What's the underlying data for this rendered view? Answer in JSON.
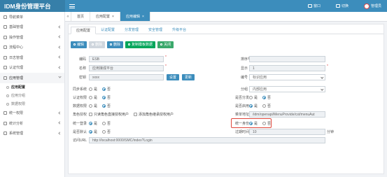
{
  "app": {
    "title": "IDM身份管理平台"
  },
  "topbar": {
    "item1": "窗口",
    "item2": "切换",
    "user": "管理员"
  },
  "sidebar": {
    "items": [
      {
        "label": "导航菜单"
      },
      {
        "label": "基础管理"
      },
      {
        "label": "操作管理"
      },
      {
        "label": "流程中心"
      },
      {
        "label": "日志管理"
      },
      {
        "label": "认证代理"
      },
      {
        "label": "应用管理"
      },
      {
        "label": "统一权限"
      },
      {
        "label": "统计分析"
      },
      {
        "label": "系统管理"
      }
    ],
    "subitems": [
      {
        "label": "应用配置"
      },
      {
        "label": "应用分组"
      },
      {
        "label": "数据权限"
      }
    ]
  },
  "page_tabs": {
    "home": "首页",
    "tab2": "应用配置",
    "tab3": "应用编辑"
  },
  "inner_tabs": [
    "应用配置",
    "认证配置",
    "分发管理",
    "安全管理",
    "升级平台"
  ],
  "toolbar": {
    "save": "编辑",
    "b2": "删除",
    "b3": "删除",
    "b4": "复制模板数据",
    "close": "关闭"
  },
  "form": {
    "code_label": "编码",
    "code_value": "ESB",
    "name_label": "名称",
    "name_value": "应用接成平台",
    "secret_label": "密钥",
    "secret_value": "xxxx",
    "set_btn": "设置",
    "refresh_btn": "更新",
    "sync_label": "同步系统",
    "sync_yes": "是",
    "sync_no": "否",
    "auth_label": "认证权限",
    "auth_yes": "是",
    "auth_no": "否",
    "data_label": "数据权限",
    "data_yes": "是",
    "data_no": "否",
    "role_label": "角色授权",
    "role_opt1": "只读角色直接授权用户",
    "role_opt2": "添加角色继承授权用户",
    "unified_label": "统一登录",
    "unified_yes": "是",
    "unified_no": "否",
    "default_label": "是否默认",
    "default_yes": "是",
    "default_no": "否",
    "url_label": "访问URL",
    "url_value": "http://localhost:0000/SMC/index?Login",
    "right_r1_label": "排序号",
    "right_r2_label": "显示",
    "right_r2_value": "1",
    "right_r3_label": "编号",
    "right_r3_value": "标识应用",
    "right_r4_label": "分组",
    "right_r4_value": "内部应用",
    "right_r5_label": "是否分发",
    "right_r5_yes": "是",
    "right_r5_no": "否",
    "right_r6_label": "是否启用",
    "right_r6_yes": "是",
    "right_r6_no": "否",
    "right_r7_label": "菜单地址",
    "right_r7_value": "/idm/openapi/MenuProvide/cst/menuAut",
    "right_r8_label": "统一身份",
    "right_r8_yes": "是",
    "right_r8_no": "否",
    "right_r9_label": "过期时间",
    "right_r9_value": "10",
    "right_r9_unit": "分钟"
  }
}
